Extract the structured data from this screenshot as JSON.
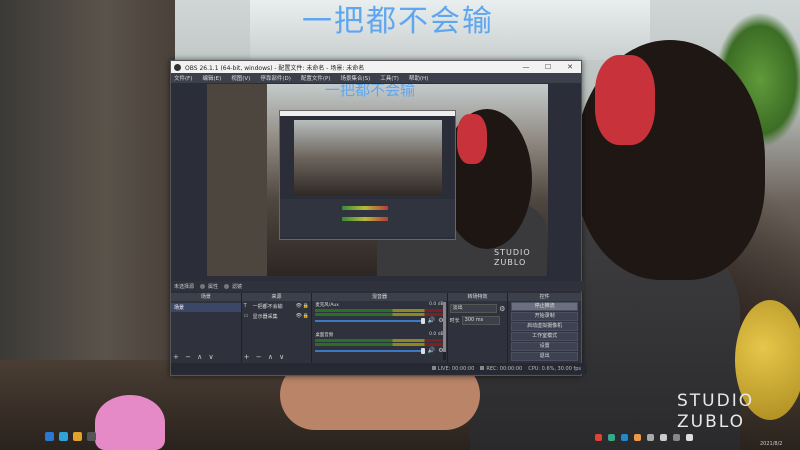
{
  "overlay": {
    "title": "一把都不会输",
    "studio_line1": "STUDIO",
    "studio_line2": "ZUBLO",
    "tray_date": "2021/8/2"
  },
  "obs": {
    "window_title": "OBS 26.1.1 (64-bit, windows) - 配置文件: 未命名 - 场景: 未命名",
    "minimize": "—",
    "maximize": "☐",
    "close": "✕",
    "menu": [
      "文件(F)",
      "编辑(E)",
      "视图(V)",
      "停靠部件(D)",
      "配置文件(P)",
      "场景集合(S)",
      "工具(T)",
      "帮助(H)"
    ],
    "preview": {
      "title": "一把都不会输",
      "studio_line1": "STUDIO",
      "studio_line2": "ZUBLO"
    },
    "status_line": {
      "label": "未选择源",
      "properties": "属性",
      "filters": "滤镜"
    },
    "docks": {
      "scenes": {
        "header": "场景",
        "items": [
          "场景"
        ]
      },
      "sources": {
        "header": "来源",
        "items": [
          {
            "icon": "T",
            "name": "一把都不会输"
          },
          {
            "icon": "▭",
            "name": "显示器采集"
          }
        ]
      },
      "mixer": {
        "header": "混音器",
        "channels": [
          {
            "name": "麦克风/Aux",
            "db": "0.0 dB"
          },
          {
            "name": "桌面音频",
            "db": "0.0 dB"
          }
        ]
      },
      "transitions": {
        "header": "转场特效",
        "type": "淡出",
        "duration_label": "时长",
        "duration": "300 ms"
      },
      "controls": {
        "header": "控件",
        "buttons": [
          "停止推流",
          "开始录制",
          "启动虚拟摄像机",
          "工作室模式",
          "设置",
          "退出"
        ]
      }
    },
    "statusbar": {
      "live": "LIVE: 00:00:00",
      "rec": "REC: 00:00:00",
      "cpu": "CPU: 0.6%, 30.00 fps"
    },
    "tools_symbols": "+ − ∧ ∨"
  }
}
